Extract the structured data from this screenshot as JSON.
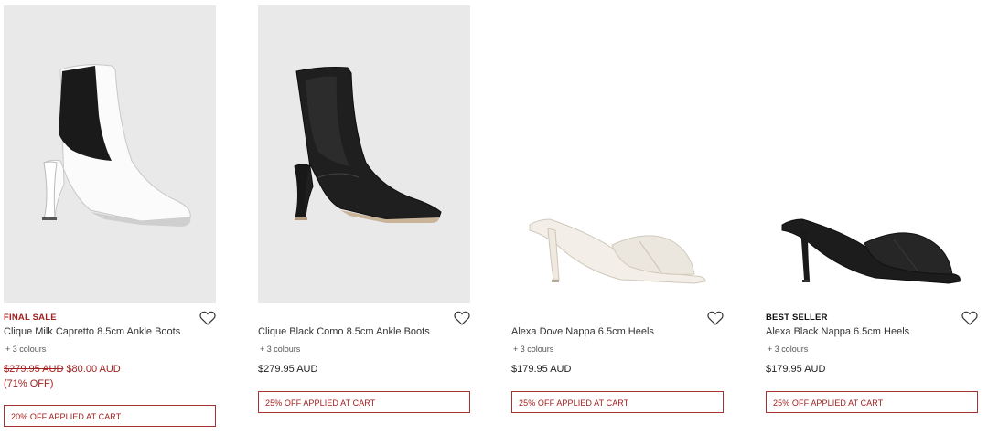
{
  "products": [
    {
      "badge": "FINAL SALE",
      "name": "Clique Milk Capretto 8.5cm Ankle Boots",
      "colours": "+ 3 colours",
      "original_price": "$279.95 AUD",
      "sale_price": "$80.00 AUD",
      "discount": "(71% OFF)",
      "promo": "20% OFF APPLIED AT CART"
    },
    {
      "name": "Clique Black Como 8.5cm Ankle Boots",
      "colours": "+ 3 colours",
      "price": "$279.95 AUD",
      "promo": "25% OFF APPLIED AT CART"
    },
    {
      "name": "Alexa Dove Nappa 6.5cm Heels",
      "colours": "+ 3 colours",
      "price": "$179.95 AUD",
      "promo": "25% OFF APPLIED AT CART"
    },
    {
      "badge": "BEST SELLER",
      "name": "Alexa Black Nappa 6.5cm Heels",
      "colours": "+ 3 colours",
      "price": "$179.95 AUD",
      "promo": "25% OFF APPLIED AT CART"
    }
  ],
  "colors": {
    "accent_red": "#a32020",
    "image_background": "#e9e9e9"
  },
  "icons": {
    "wishlist": "heart-outline-icon"
  }
}
